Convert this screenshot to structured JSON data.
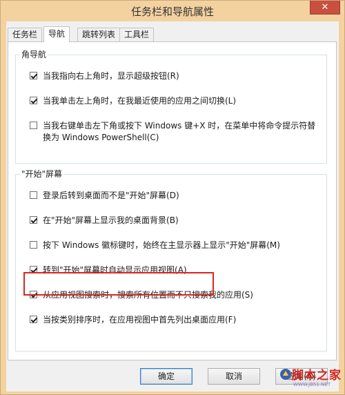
{
  "window": {
    "title": "任务栏和导航属性",
    "close_glyph": "✕"
  },
  "tabs": [
    {
      "label": "任务栏",
      "active": false
    },
    {
      "label": "导航",
      "active": true
    },
    {
      "label": "跳转列表",
      "active": false
    },
    {
      "label": "工具栏",
      "active": false
    }
  ],
  "corner_group": {
    "title": "角导航",
    "options": [
      {
        "label": "当我指向右上角时，显示超级按钮(R)",
        "checked": true
      },
      {
        "label": "当我单击左上角时，在我最近使用的应用之间切换(L)",
        "checked": true
      },
      {
        "label": "当我右键单击左下角或按下 Windows 键+X 时，在菜单中将命令提示符替换为 Windows PowerShell(C)",
        "checked": false
      }
    ]
  },
  "start_group": {
    "title": "\"开始\"屏幕",
    "options": [
      {
        "label": "登录后转到桌面而不是\"开始\"屏幕(D)",
        "checked": false
      },
      {
        "label": "在\"开始\"屏幕上显示我的桌面背景(B)",
        "checked": true
      },
      {
        "label": "按下 Windows 徽标键时，始终在主显示器上显示\"开始\"屏幕(M)",
        "checked": false
      },
      {
        "label": "转到\"开始\"屏幕时自动显示应用视图(A)",
        "checked": true
      },
      {
        "label": "从应用视图搜索时，搜索所有位置而不只搜索我的应用(S)",
        "checked": true
      },
      {
        "label": "当按类别排序时，在应用视图中首先列出桌面应用(F)",
        "checked": true
      }
    ]
  },
  "buttons": {
    "ok": "确定",
    "cancel": "取消",
    "apply": "应用(A)"
  },
  "watermark": {
    "text": "脚本之家",
    "url": "WWW.JB51.NET"
  }
}
